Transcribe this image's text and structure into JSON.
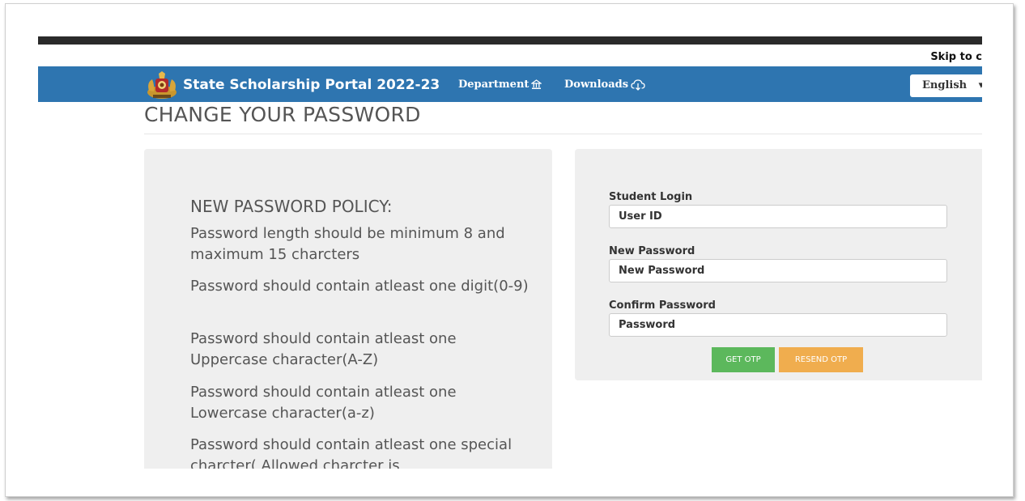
{
  "header": {
    "skip_link": "Skip to c",
    "brand_title": "State Scholarship Portal 2022-23",
    "nav": {
      "department_label": "Department",
      "downloads_label": "Downloads"
    },
    "language": {
      "selected": "English"
    }
  },
  "page": {
    "title": "CHANGE YOUR PASSWORD"
  },
  "policy": {
    "heading": "NEW PASSWORD POLICY:",
    "rules": [
      "Password length should be minimum 8 and maximum 15 charcters",
      "Password should contain atleast one digit(0-9)",
      "Password should contain atleast one Uppercase character(A-Z)",
      "Password should contain atleast one Lowercase character(a-z)",
      "Password should contain atleast one special charcter( Allowed charcter is"
    ]
  },
  "form": {
    "student_login_label": "Student Login",
    "user_id_placeholder": "User ID",
    "new_password_label": "New Password",
    "new_password_placeholder": "New Password",
    "confirm_password_label": "Confirm Password",
    "confirm_password_placeholder": "Password",
    "get_otp_label": "GET OTP",
    "resend_otp_label": "RESEND OTP"
  },
  "colors": {
    "navbar": "#2e75b0",
    "get_otp": "#5cb85c",
    "resend_otp": "#f0ad4e",
    "panel": "#efefef"
  },
  "icons": [
    "state-emblem-logo",
    "bank-icon",
    "download-cloud-icon",
    "chevron-down-icon"
  ]
}
